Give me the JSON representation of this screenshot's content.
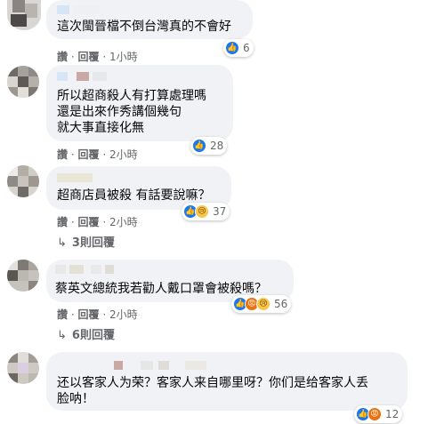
{
  "comments": [
    {
      "text": "這次閩晉檔不倒台灣真的不會好",
      "reactions": {
        "icons": [
          "like-icon"
        ],
        "count": "6"
      },
      "meta": {
        "like": "讚",
        "reply": "回覆",
        "time": "1小時"
      }
    },
    {
      "text": "所以超商殺人有打算處理嗎\n還是出來作秀講個幾句\n就大事直接化無",
      "reactions": {
        "icons": [
          "like-icon"
        ],
        "count": "28"
      },
      "meta": {
        "like": "讚",
        "reply": "回覆",
        "time": "2小時"
      }
    },
    {
      "text": "超商店員被殺 有話要說嘛？",
      "reactions": {
        "icons": [
          "like-icon",
          "sad-icon"
        ],
        "count": "37"
      },
      "meta": {
        "like": "讚",
        "reply": "回覆",
        "time": "2小時"
      },
      "replies": "3則回覆"
    },
    {
      "text": "蔡英文總統我若勸人戴口罩會被殺嗎？",
      "reactions": {
        "icons": [
          "like-icon",
          "angry-icon",
          "sad-icon"
        ],
        "count": "56"
      },
      "meta": {
        "like": "讚",
        "reply": "回覆",
        "time": "2小時"
      },
      "replies": "6則回覆"
    },
    {
      "text": "还以客家人为荣？客家人来自哪里呀？你们是给客家人丢\n脸呐！",
      "reactions": {
        "icons": [
          "like-icon",
          "angry-icon"
        ],
        "count": "12"
      }
    }
  ],
  "separator": "·",
  "colors": {
    "bubble": "#f0f2f5",
    "meta": "#65676b",
    "like": "#1877f2"
  }
}
